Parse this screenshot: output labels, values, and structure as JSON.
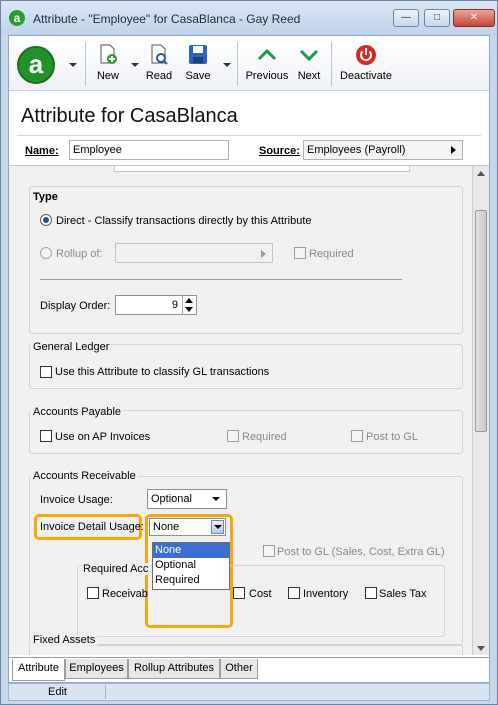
{
  "window": {
    "title": "Attribute - \"Employee\" for CasaBlanca - Gay Reed",
    "app_icon": "a",
    "minimize": "—",
    "maximize": "□",
    "close": "✕"
  },
  "toolbar": {
    "logo": "a",
    "new": "New",
    "read": "Read",
    "save": "Save",
    "previous": "Previous",
    "next": "Next",
    "deactivate": "Deactivate"
  },
  "header": {
    "title": "Attribute for CasaBlanca",
    "name_label": "Name:",
    "name_value": "Employee",
    "source_label": "Source:",
    "source_value": "Employees (Payroll)"
  },
  "type_group": {
    "title": "Type",
    "direct_label": "Direct - Classify transactions directly by this Attribute",
    "rollup_label": "Rollup of:",
    "rollup_required_label": "Required",
    "display_order_label": "Display Order:",
    "display_order_value": "9"
  },
  "general_ledger": {
    "title": "General Ledger",
    "use_label": "Use this Attribute to classify GL transactions"
  },
  "accounts_payable": {
    "title": "Accounts Payable",
    "use_label": "Use on AP Invoices",
    "required_label": "Required",
    "post_label": "Post to GL"
  },
  "accounts_receivable": {
    "title": "Accounts Receivable",
    "invoice_usage_label": "Invoice Usage:",
    "invoice_usage_value": "Optional",
    "detail_usage_label": "Invoice Detail Usage:",
    "detail_usage_value": "None",
    "post_label": "Post to GL (Sales, Cost, Extra GL)",
    "required_acc_label": "Required Acc",
    "receivable_label": "Receivab",
    "cost_label": "Cost",
    "inventory_label": "Inventory",
    "sales_tax_label": "Sales Tax",
    "dropdown_options": [
      "None",
      "Optional",
      "Required"
    ],
    "dropdown_selected": "None"
  },
  "fixed_assets": {
    "title": "Fixed Assets"
  },
  "tabs": [
    "Attribute",
    "Employees",
    "Rollup Attributes",
    "Other"
  ],
  "status": {
    "mode": "Edit"
  },
  "colors": {
    "highlight": "#f3a712",
    "selection": "#3a6fd0",
    "accent": "#23922a"
  }
}
